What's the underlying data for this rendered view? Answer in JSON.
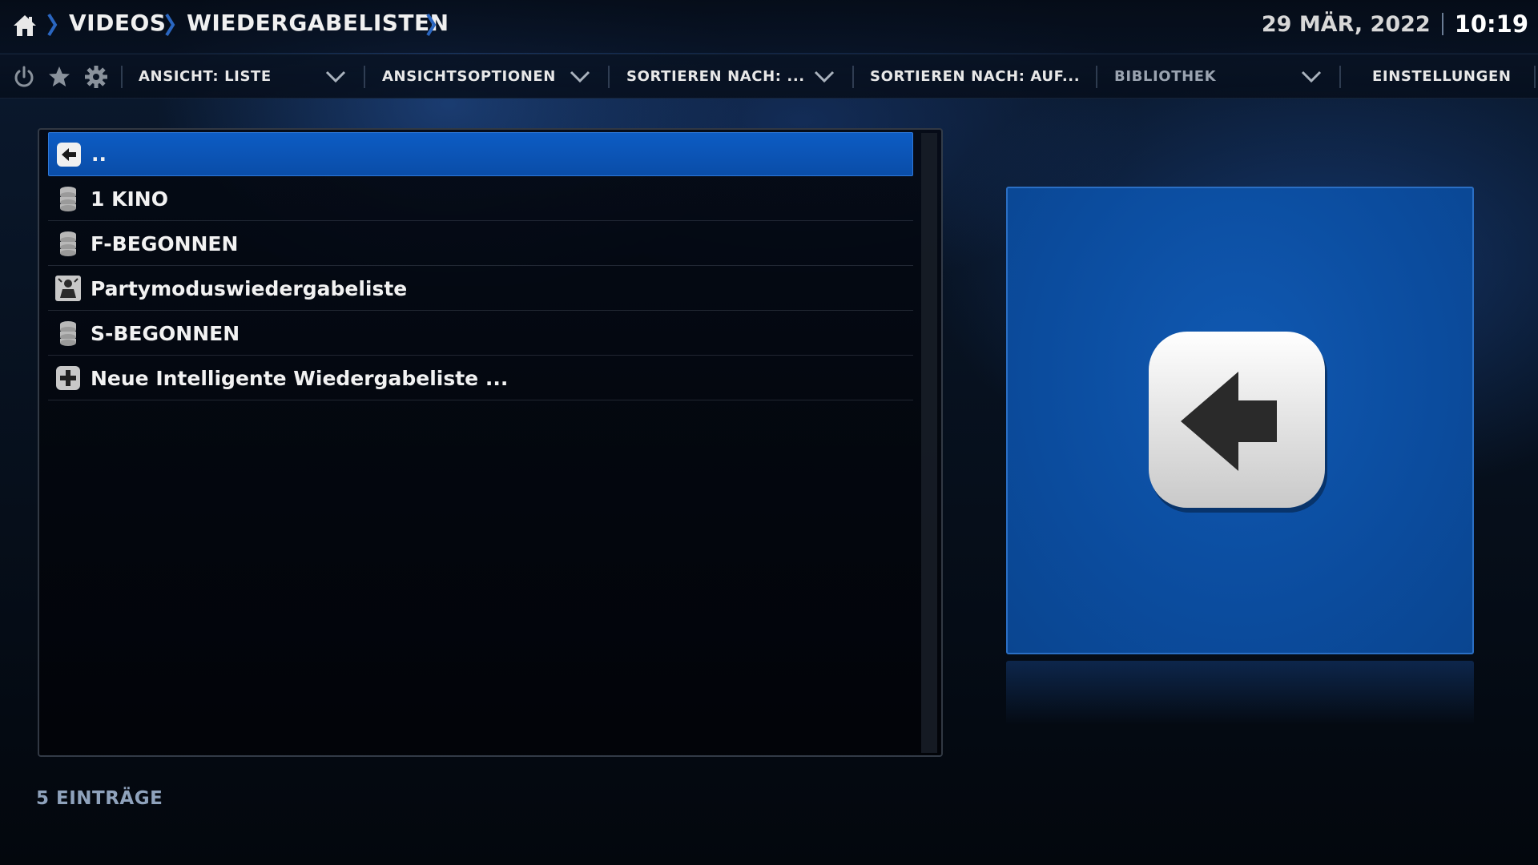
{
  "breadcrumb": {
    "items": [
      "VIDEOS",
      "WIEDERGABELISTEN"
    ]
  },
  "datetime": {
    "date": "29 MÄR, 2022",
    "time": "10:19"
  },
  "menubar": {
    "view": "ANSICHT: LISTE",
    "view_options": "ANSICHTSOPTIONEN",
    "sort_by": "SORTIEREN NACH: ...",
    "sort_order": "SORTIEREN NACH: AUF...",
    "library": "BIBLIOTHEK",
    "settings": "EINSTELLUNGEN"
  },
  "list": {
    "items": [
      {
        "label": "..",
        "icon": "back-arrow-icon",
        "selected": true
      },
      {
        "label": "1 KINO",
        "icon": "database-icon"
      },
      {
        "label": "F-BEGONNEN",
        "icon": "database-icon"
      },
      {
        "label": "Partymoduswiedergabeliste",
        "icon": "party-person-icon"
      },
      {
        "label": "S-BEGONNEN",
        "icon": "database-icon"
      },
      {
        "label": "Neue Intelligente Wiedergabeliste ...",
        "icon": "plus-icon"
      }
    ]
  },
  "status": {
    "count": "5 EINTRÄGE"
  },
  "colors": {
    "accent": "#0d5cc4",
    "preview_bg": "#0b4c9e"
  }
}
